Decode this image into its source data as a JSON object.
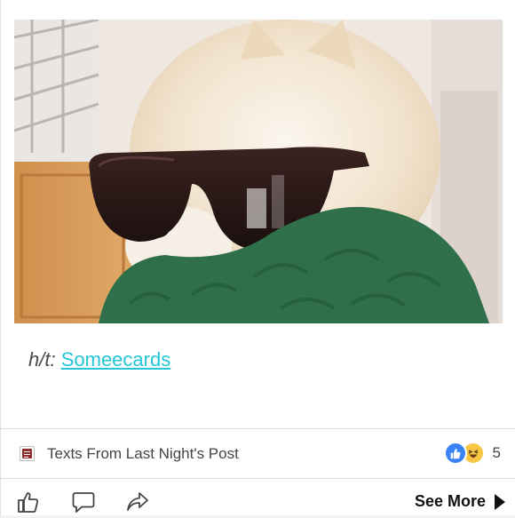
{
  "post": {
    "attribution_prefix": "h/t:",
    "attribution_link": "Someecards",
    "source_name": "Texts From Last Night's Post",
    "reaction_count": "5",
    "reactions": [
      "like-icon",
      "haha-icon"
    ],
    "see_more_label": "See More"
  },
  "actions": [
    "like-button",
    "comment-button",
    "share-button"
  ],
  "colors": {
    "link": "#22c6d6",
    "like": "#3b82f6",
    "haha": "#f7c744"
  }
}
